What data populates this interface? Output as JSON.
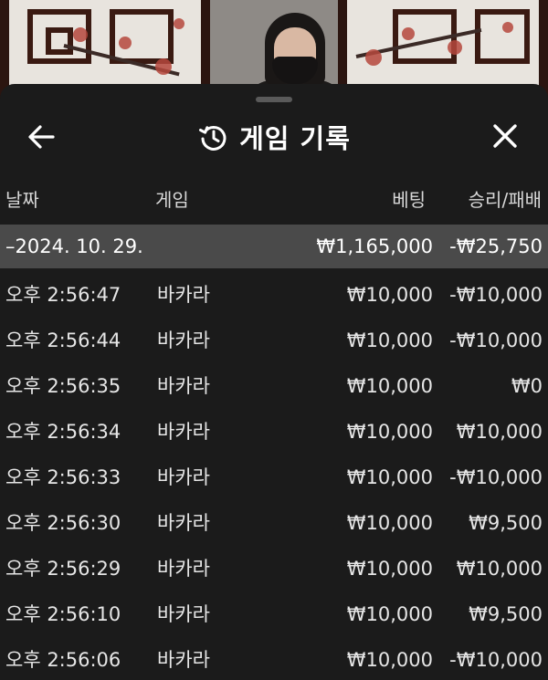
{
  "header": {
    "title": "게임 기록"
  },
  "icons": {
    "back": "arrow-left-icon",
    "history": "history-icon",
    "close": "close-icon"
  },
  "table": {
    "columns": {
      "date": "날짜",
      "game": "게임",
      "bet": "베팅",
      "result": "승리/패배"
    },
    "summary": {
      "date": "–2024. 10. 29.",
      "bet": "₩1,165,000",
      "result": "-₩25,750"
    },
    "rows": [
      {
        "time": "오후 2:56:47",
        "game": "바카라",
        "bet": "₩10,000",
        "result": "-₩10,000"
      },
      {
        "time": "오후 2:56:44",
        "game": "바카라",
        "bet": "₩10,000",
        "result": "-₩10,000"
      },
      {
        "time": "오후 2:56:35",
        "game": "바카라",
        "bet": "₩10,000",
        "result": "₩0"
      },
      {
        "time": "오후 2:56:34",
        "game": "바카라",
        "bet": "₩10,000",
        "result": "₩10,000"
      },
      {
        "time": "오후 2:56:33",
        "game": "바카라",
        "bet": "₩10,000",
        "result": "-₩10,000"
      },
      {
        "time": "오후 2:56:30",
        "game": "바카라",
        "bet": "₩10,000",
        "result": "₩9,500"
      },
      {
        "time": "오후 2:56:29",
        "game": "바카라",
        "bet": "₩10,000",
        "result": "₩10,000"
      },
      {
        "time": "오후 2:56:10",
        "game": "바카라",
        "bet": "₩10,000",
        "result": "₩9,500"
      },
      {
        "time": "오후 2:56:06",
        "game": "바카라",
        "bet": "₩10,000",
        "result": "-₩10,000"
      }
    ]
  },
  "colors": {
    "sheet_background": "#1b1b1b",
    "summary_row_background": "#4a4a4a",
    "text": "#ffffff"
  }
}
